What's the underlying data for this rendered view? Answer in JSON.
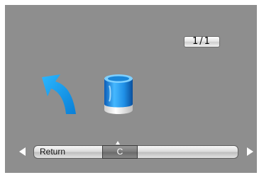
{
  "page_indicator": "1/1",
  "icons": {
    "back": "back-arrow-icon",
    "storage": "storage-cylinder-icon",
    "prev": "left-arrow-icon",
    "next": "right-arrow-icon"
  },
  "bottom_bar": {
    "items": [
      "Return",
      "C"
    ],
    "selected_index": 1
  },
  "colors": {
    "screen_bg": "#8e8e8e",
    "accent_blue": "#1aa3ff",
    "arrow_white": "#ffffff"
  }
}
